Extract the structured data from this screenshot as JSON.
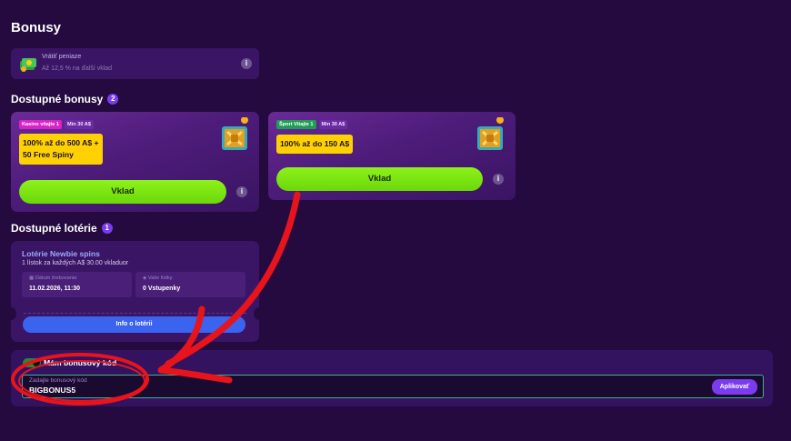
{
  "page": {
    "title": "Bonusy"
  },
  "cashback": {
    "title": "Vrátiť peniaze",
    "subtitle": "Až 12,5 % na ďalší vklad",
    "info": "i"
  },
  "available_bonuses": {
    "title": "Dostupné bonusy",
    "count": "2",
    "cards": [
      {
        "tag": "Kasíno vitajte 1",
        "min": "Min 30 A$",
        "offer_line1": "100% až do 500 A$ +",
        "offer_line2": "50 Free Spiny",
        "button": "Vklad",
        "info": "i"
      },
      {
        "tag": "Šport Vitajte 1",
        "min": "Min 30 A$",
        "offer_line1": "100% až do 150 A$",
        "button": "Vklad",
        "info": "i"
      }
    ]
  },
  "lotteries": {
    "title": "Dostupné lotérie",
    "count": "1",
    "card": {
      "name": "Lotérie Newbie spins",
      "description": "1 lístok za každých A$ 30.00 vkladuor",
      "draw_date_label": "Dátum žrebovania",
      "draw_date": "11.02.2026, 11:30",
      "tickets_label": "Vaše lístky",
      "tickets": "0 Vstupenky",
      "button": "Info o lotérii"
    }
  },
  "bonus_code": {
    "toggle_label": "Mám bonusový kód",
    "field_placeholder": "Zadajte bonusový kód",
    "field_value": "BIGBONUS5",
    "apply_button": "Aplikovať"
  },
  "colors": {
    "background": "#240a3f",
    "panel": "#3b1565",
    "accent_purple": "#7b3cf0",
    "deposit_green": "#7ee314",
    "offer_yellow": "#ffd100",
    "lottery_blue": "#3a63f0",
    "annotation_red": "#e8141c"
  }
}
